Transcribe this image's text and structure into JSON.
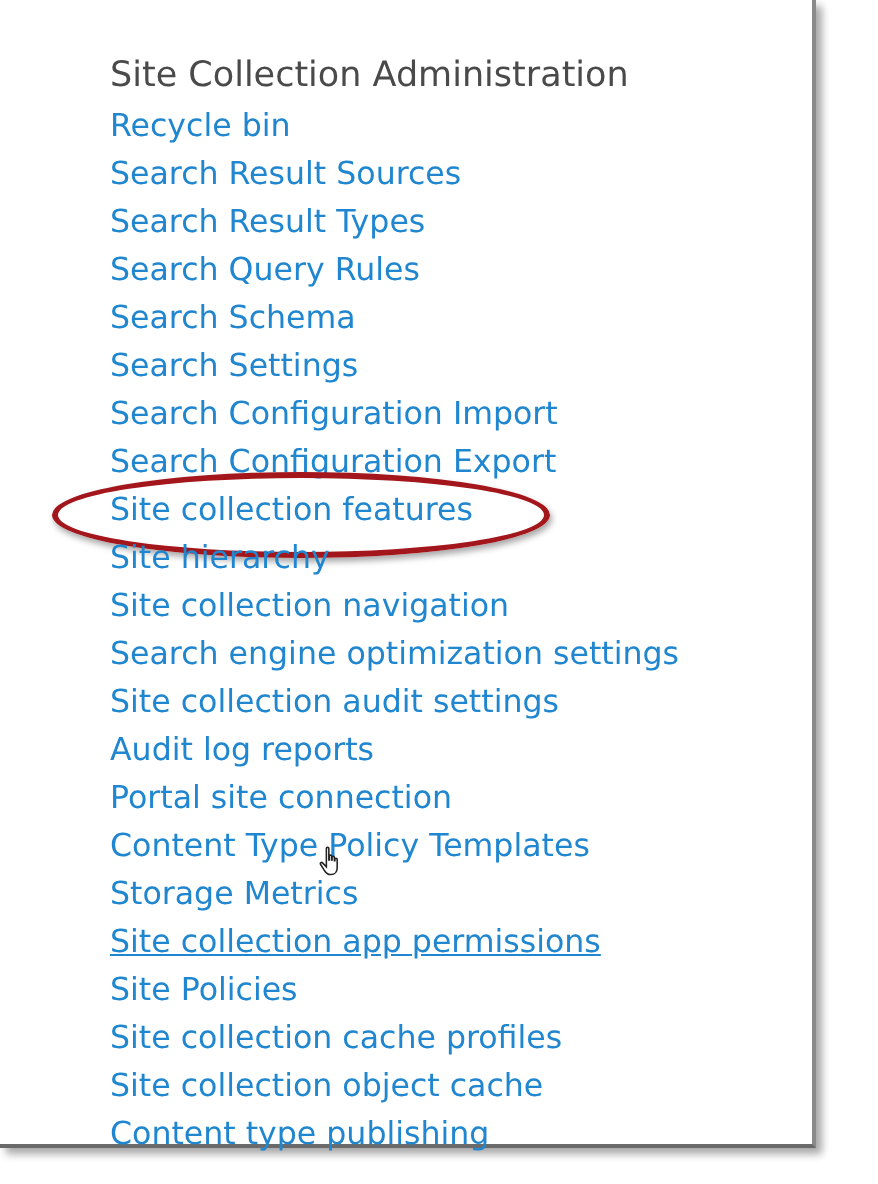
{
  "section": {
    "title": "Site Collection Administration"
  },
  "links": [
    {
      "label": "Recycle bin",
      "underlined": false,
      "circled": false,
      "cursor": false
    },
    {
      "label": "Search Result Sources",
      "underlined": false,
      "circled": false,
      "cursor": false
    },
    {
      "label": "Search Result Types",
      "underlined": false,
      "circled": false,
      "cursor": false
    },
    {
      "label": "Search Query Rules",
      "underlined": false,
      "circled": false,
      "cursor": false
    },
    {
      "label": "Search Schema",
      "underlined": false,
      "circled": false,
      "cursor": false
    },
    {
      "label": "Search Settings",
      "underlined": false,
      "circled": false,
      "cursor": false
    },
    {
      "label": "Search Configuration Import",
      "underlined": false,
      "circled": false,
      "cursor": false
    },
    {
      "label": "Search Configuration Export",
      "underlined": false,
      "circled": false,
      "cursor": false
    },
    {
      "label": "Site collection features",
      "underlined": false,
      "circled": true,
      "cursor": false
    },
    {
      "label": "Site hierarchy",
      "underlined": false,
      "circled": false,
      "cursor": false
    },
    {
      "label": "Site collection navigation",
      "underlined": false,
      "circled": false,
      "cursor": false
    },
    {
      "label": "Search engine optimization settings",
      "underlined": false,
      "circled": false,
      "cursor": false
    },
    {
      "label": "Site collection audit settings",
      "underlined": false,
      "circled": false,
      "cursor": false
    },
    {
      "label": "Audit log reports",
      "underlined": false,
      "circled": false,
      "cursor": false
    },
    {
      "label": "Portal site connection",
      "underlined": false,
      "circled": false,
      "cursor": false
    },
    {
      "label": "Content Type Policy Templates",
      "underlined": false,
      "circled": false,
      "cursor": true
    },
    {
      "label": "Storage Metrics",
      "underlined": false,
      "circled": false,
      "cursor": false
    },
    {
      "label": "Site collection app permissions",
      "underlined": true,
      "circled": false,
      "cursor": false
    },
    {
      "label": "Site Policies",
      "underlined": false,
      "circled": false,
      "cursor": false
    },
    {
      "label": "Site collection cache profiles",
      "underlined": false,
      "circled": false,
      "cursor": false
    },
    {
      "label": "Site collection object cache",
      "underlined": false,
      "circled": false,
      "cursor": false
    },
    {
      "label": "Content type publishing",
      "underlined": false,
      "circled": false,
      "cursor": false
    }
  ]
}
